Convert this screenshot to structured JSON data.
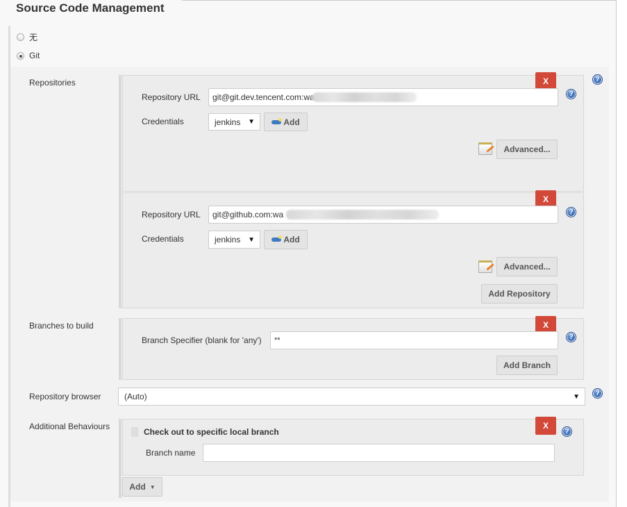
{
  "section": {
    "title": "Source Code Management"
  },
  "scm_options": [
    {
      "label": "无",
      "checked": false
    },
    {
      "label": "Git",
      "checked": true
    }
  ],
  "repositories": {
    "label": "Repositories",
    "items": [
      {
        "url_label": "Repository URL",
        "url_value": "git@git.dev.tencent.com:wa",
        "credentials_label": "Credentials",
        "credentials_value": "jenkins",
        "add_label": "Add",
        "advanced_label": "Advanced...",
        "delete_label": "X"
      },
      {
        "url_label": "Repository URL",
        "url_value": "git@github.com:wa",
        "credentials_label": "Credentials",
        "credentials_value": "jenkins",
        "add_label": "Add",
        "advanced_label": "Advanced...",
        "delete_label": "X"
      }
    ],
    "add_repository_label": "Add Repository"
  },
  "branches": {
    "label": "Branches to build",
    "specifier_label": "Branch Specifier (blank for 'any')",
    "specifier_value": "**",
    "delete_label": "X",
    "add_branch_label": "Add Branch"
  },
  "repository_browser": {
    "label": "Repository browser",
    "value": "(Auto)"
  },
  "additional_behaviours": {
    "label": "Additional Behaviours",
    "items": [
      {
        "title": "Check out to specific local branch",
        "field_label": "Branch name",
        "field_value": "",
        "delete_label": "X"
      }
    ],
    "add_label": "Add"
  },
  "icons": {
    "help": "?",
    "caret": "▼"
  },
  "colors": {
    "delete": "#d24939",
    "help": "#1d4f9e"
  }
}
